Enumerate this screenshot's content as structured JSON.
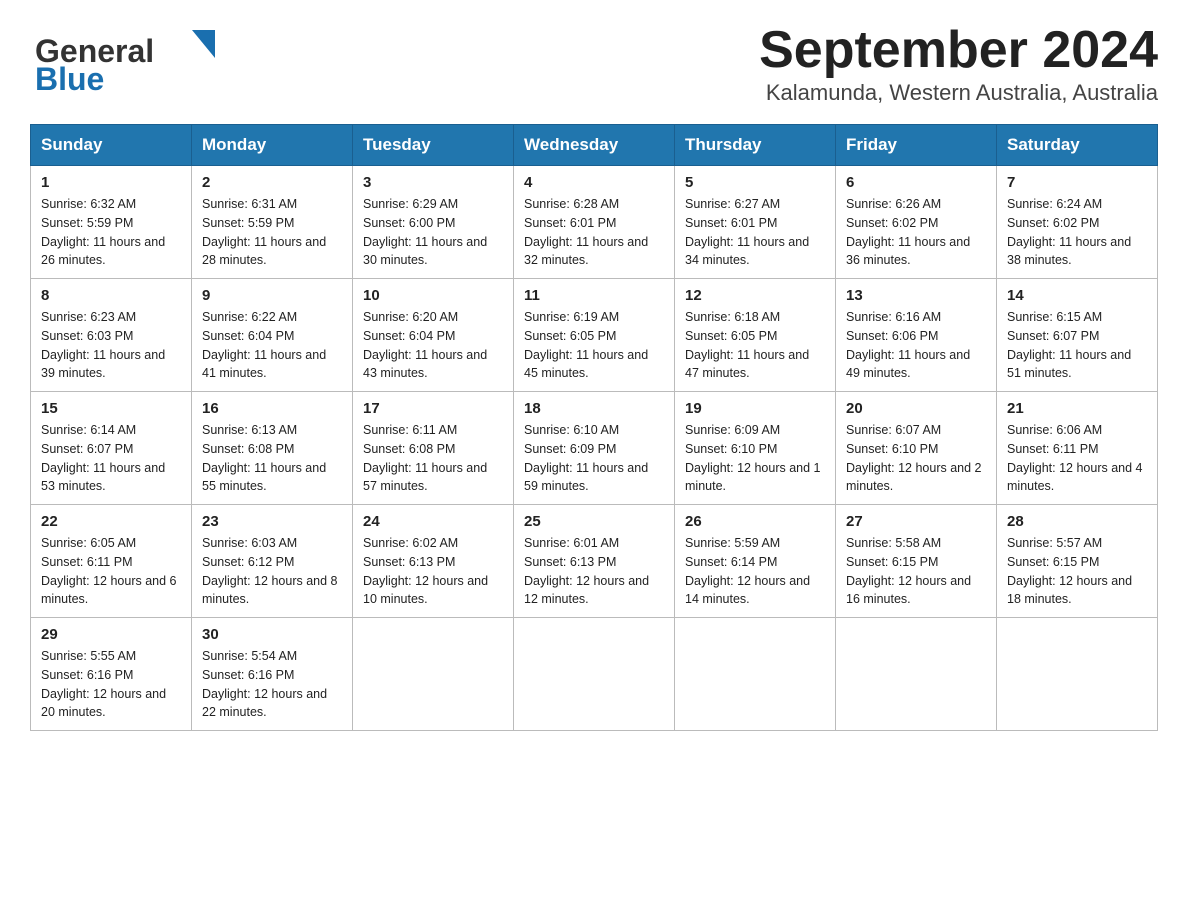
{
  "header": {
    "logo_line1": "General",
    "logo_line2": "Blue",
    "title": "September 2024",
    "subtitle": "Kalamunda, Western Australia, Australia"
  },
  "calendar": {
    "days_of_week": [
      "Sunday",
      "Monday",
      "Tuesday",
      "Wednesday",
      "Thursday",
      "Friday",
      "Saturday"
    ],
    "weeks": [
      [
        {
          "date": "1",
          "sunrise": "6:32 AM",
          "sunset": "5:59 PM",
          "daylight": "11 hours and 26 minutes."
        },
        {
          "date": "2",
          "sunrise": "6:31 AM",
          "sunset": "5:59 PM",
          "daylight": "11 hours and 28 minutes."
        },
        {
          "date": "3",
          "sunrise": "6:29 AM",
          "sunset": "6:00 PM",
          "daylight": "11 hours and 30 minutes."
        },
        {
          "date": "4",
          "sunrise": "6:28 AM",
          "sunset": "6:01 PM",
          "daylight": "11 hours and 32 minutes."
        },
        {
          "date": "5",
          "sunrise": "6:27 AM",
          "sunset": "6:01 PM",
          "daylight": "11 hours and 34 minutes."
        },
        {
          "date": "6",
          "sunrise": "6:26 AM",
          "sunset": "6:02 PM",
          "daylight": "11 hours and 36 minutes."
        },
        {
          "date": "7",
          "sunrise": "6:24 AM",
          "sunset": "6:02 PM",
          "daylight": "11 hours and 38 minutes."
        }
      ],
      [
        {
          "date": "8",
          "sunrise": "6:23 AM",
          "sunset": "6:03 PM",
          "daylight": "11 hours and 39 minutes."
        },
        {
          "date": "9",
          "sunrise": "6:22 AM",
          "sunset": "6:04 PM",
          "daylight": "11 hours and 41 minutes."
        },
        {
          "date": "10",
          "sunrise": "6:20 AM",
          "sunset": "6:04 PM",
          "daylight": "11 hours and 43 minutes."
        },
        {
          "date": "11",
          "sunrise": "6:19 AM",
          "sunset": "6:05 PM",
          "daylight": "11 hours and 45 minutes."
        },
        {
          "date": "12",
          "sunrise": "6:18 AM",
          "sunset": "6:05 PM",
          "daylight": "11 hours and 47 minutes."
        },
        {
          "date": "13",
          "sunrise": "6:16 AM",
          "sunset": "6:06 PM",
          "daylight": "11 hours and 49 minutes."
        },
        {
          "date": "14",
          "sunrise": "6:15 AM",
          "sunset": "6:07 PM",
          "daylight": "11 hours and 51 minutes."
        }
      ],
      [
        {
          "date": "15",
          "sunrise": "6:14 AM",
          "sunset": "6:07 PM",
          "daylight": "11 hours and 53 minutes."
        },
        {
          "date": "16",
          "sunrise": "6:13 AM",
          "sunset": "6:08 PM",
          "daylight": "11 hours and 55 minutes."
        },
        {
          "date": "17",
          "sunrise": "6:11 AM",
          "sunset": "6:08 PM",
          "daylight": "11 hours and 57 minutes."
        },
        {
          "date": "18",
          "sunrise": "6:10 AM",
          "sunset": "6:09 PM",
          "daylight": "11 hours and 59 minutes."
        },
        {
          "date": "19",
          "sunrise": "6:09 AM",
          "sunset": "6:10 PM",
          "daylight": "12 hours and 1 minute."
        },
        {
          "date": "20",
          "sunrise": "6:07 AM",
          "sunset": "6:10 PM",
          "daylight": "12 hours and 2 minutes."
        },
        {
          "date": "21",
          "sunrise": "6:06 AM",
          "sunset": "6:11 PM",
          "daylight": "12 hours and 4 minutes."
        }
      ],
      [
        {
          "date": "22",
          "sunrise": "6:05 AM",
          "sunset": "6:11 PM",
          "daylight": "12 hours and 6 minutes."
        },
        {
          "date": "23",
          "sunrise": "6:03 AM",
          "sunset": "6:12 PM",
          "daylight": "12 hours and 8 minutes."
        },
        {
          "date": "24",
          "sunrise": "6:02 AM",
          "sunset": "6:13 PM",
          "daylight": "12 hours and 10 minutes."
        },
        {
          "date": "25",
          "sunrise": "6:01 AM",
          "sunset": "6:13 PM",
          "daylight": "12 hours and 12 minutes."
        },
        {
          "date": "26",
          "sunrise": "5:59 AM",
          "sunset": "6:14 PM",
          "daylight": "12 hours and 14 minutes."
        },
        {
          "date": "27",
          "sunrise": "5:58 AM",
          "sunset": "6:15 PM",
          "daylight": "12 hours and 16 minutes."
        },
        {
          "date": "28",
          "sunrise": "5:57 AM",
          "sunset": "6:15 PM",
          "daylight": "12 hours and 18 minutes."
        }
      ],
      [
        {
          "date": "29",
          "sunrise": "5:55 AM",
          "sunset": "6:16 PM",
          "daylight": "12 hours and 20 minutes."
        },
        {
          "date": "30",
          "sunrise": "5:54 AM",
          "sunset": "6:16 PM",
          "daylight": "12 hours and 22 minutes."
        },
        null,
        null,
        null,
        null,
        null
      ]
    ]
  }
}
